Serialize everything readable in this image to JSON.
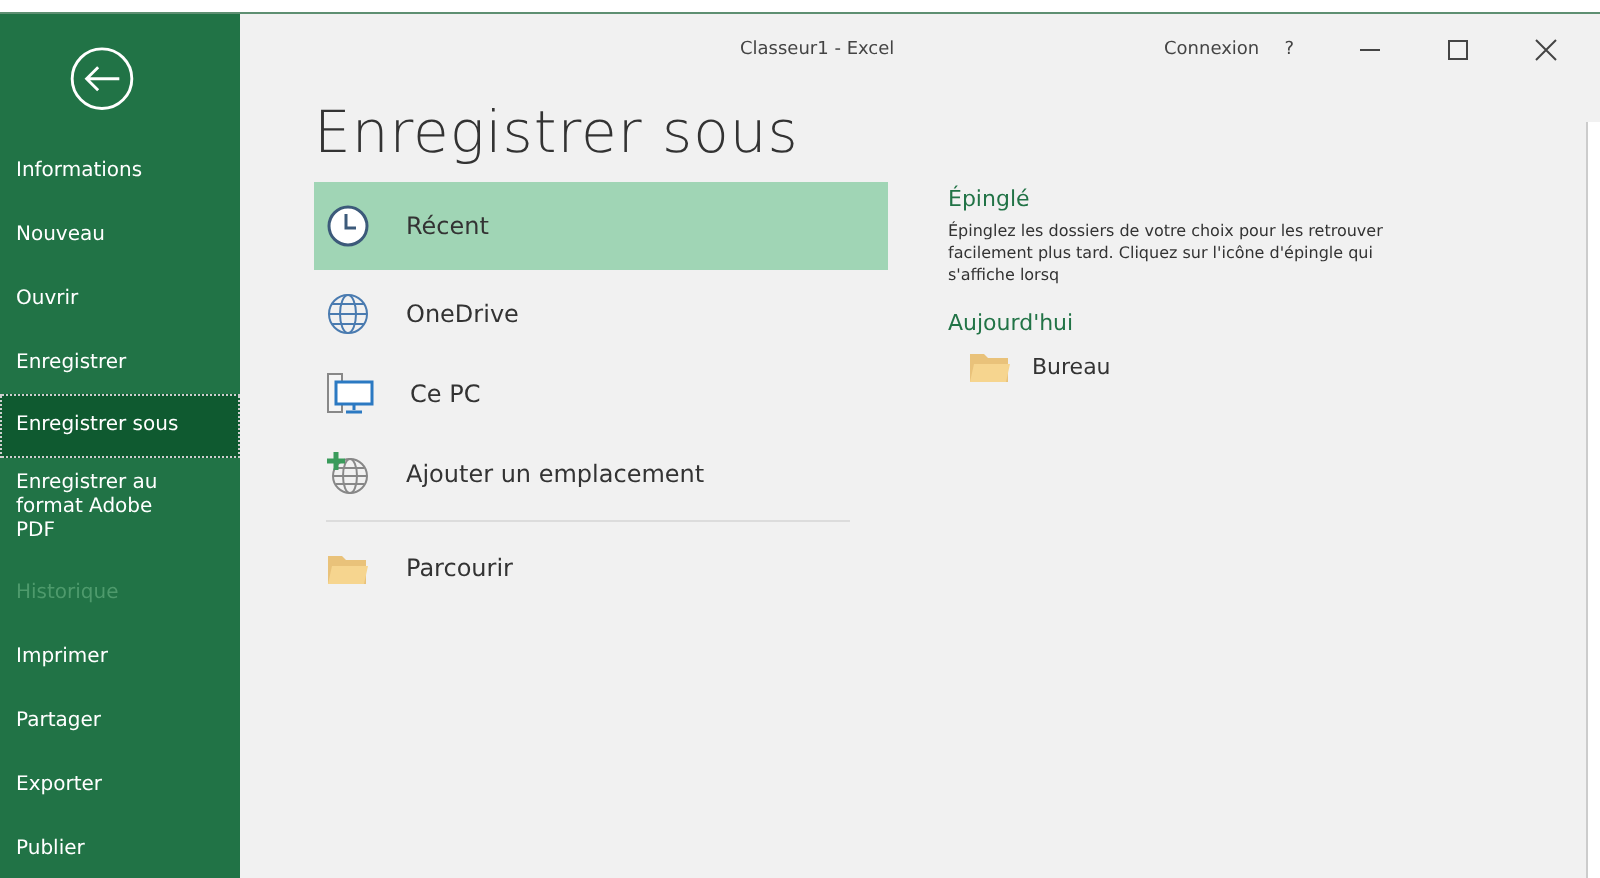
{
  "window": {
    "title": "Classeur1  -  Excel",
    "sign_in": "Connexion",
    "help": "?"
  },
  "sidebar": {
    "items": [
      {
        "label": "Informations",
        "selected": false,
        "disabled": false
      },
      {
        "label": "Nouveau",
        "selected": false,
        "disabled": false
      },
      {
        "label": "Ouvrir",
        "selected": false,
        "disabled": false
      },
      {
        "label": "Enregistrer",
        "selected": false,
        "disabled": false
      },
      {
        "label": "Enregistrer sous",
        "selected": true,
        "disabled": false
      },
      {
        "label": "Enregistrer au format Adobe PDF",
        "selected": false,
        "disabled": false
      },
      {
        "label": "Historique",
        "selected": false,
        "disabled": true
      },
      {
        "label": "Imprimer",
        "selected": false,
        "disabled": false
      },
      {
        "label": "Partager",
        "selected": false,
        "disabled": false
      },
      {
        "label": "Exporter",
        "selected": false,
        "disabled": false
      },
      {
        "label": "Publier",
        "selected": false,
        "disabled": false
      }
    ]
  },
  "heading": "Enregistrer sous",
  "locations": [
    {
      "kind": "clock",
      "label": "Récent",
      "selected": true
    },
    {
      "kind": "globe",
      "label": "OneDrive",
      "selected": false
    },
    {
      "kind": "pc",
      "label": "Ce PC",
      "selected": false
    },
    {
      "kind": "add",
      "label": "Ajouter un emplacement",
      "selected": false
    },
    {
      "kind": "folder",
      "label": "Parcourir",
      "selected": false
    }
  ],
  "pinned": {
    "title": "Épinglé",
    "text": "Épinglez les dossiers de votre choix pour les retrouver facilement plus tard. Cliquez sur l'icône d'épingle qui s'affiche lorsq"
  },
  "today": {
    "title": "Aujourd'hui",
    "folders": [
      "Bureau"
    ]
  }
}
